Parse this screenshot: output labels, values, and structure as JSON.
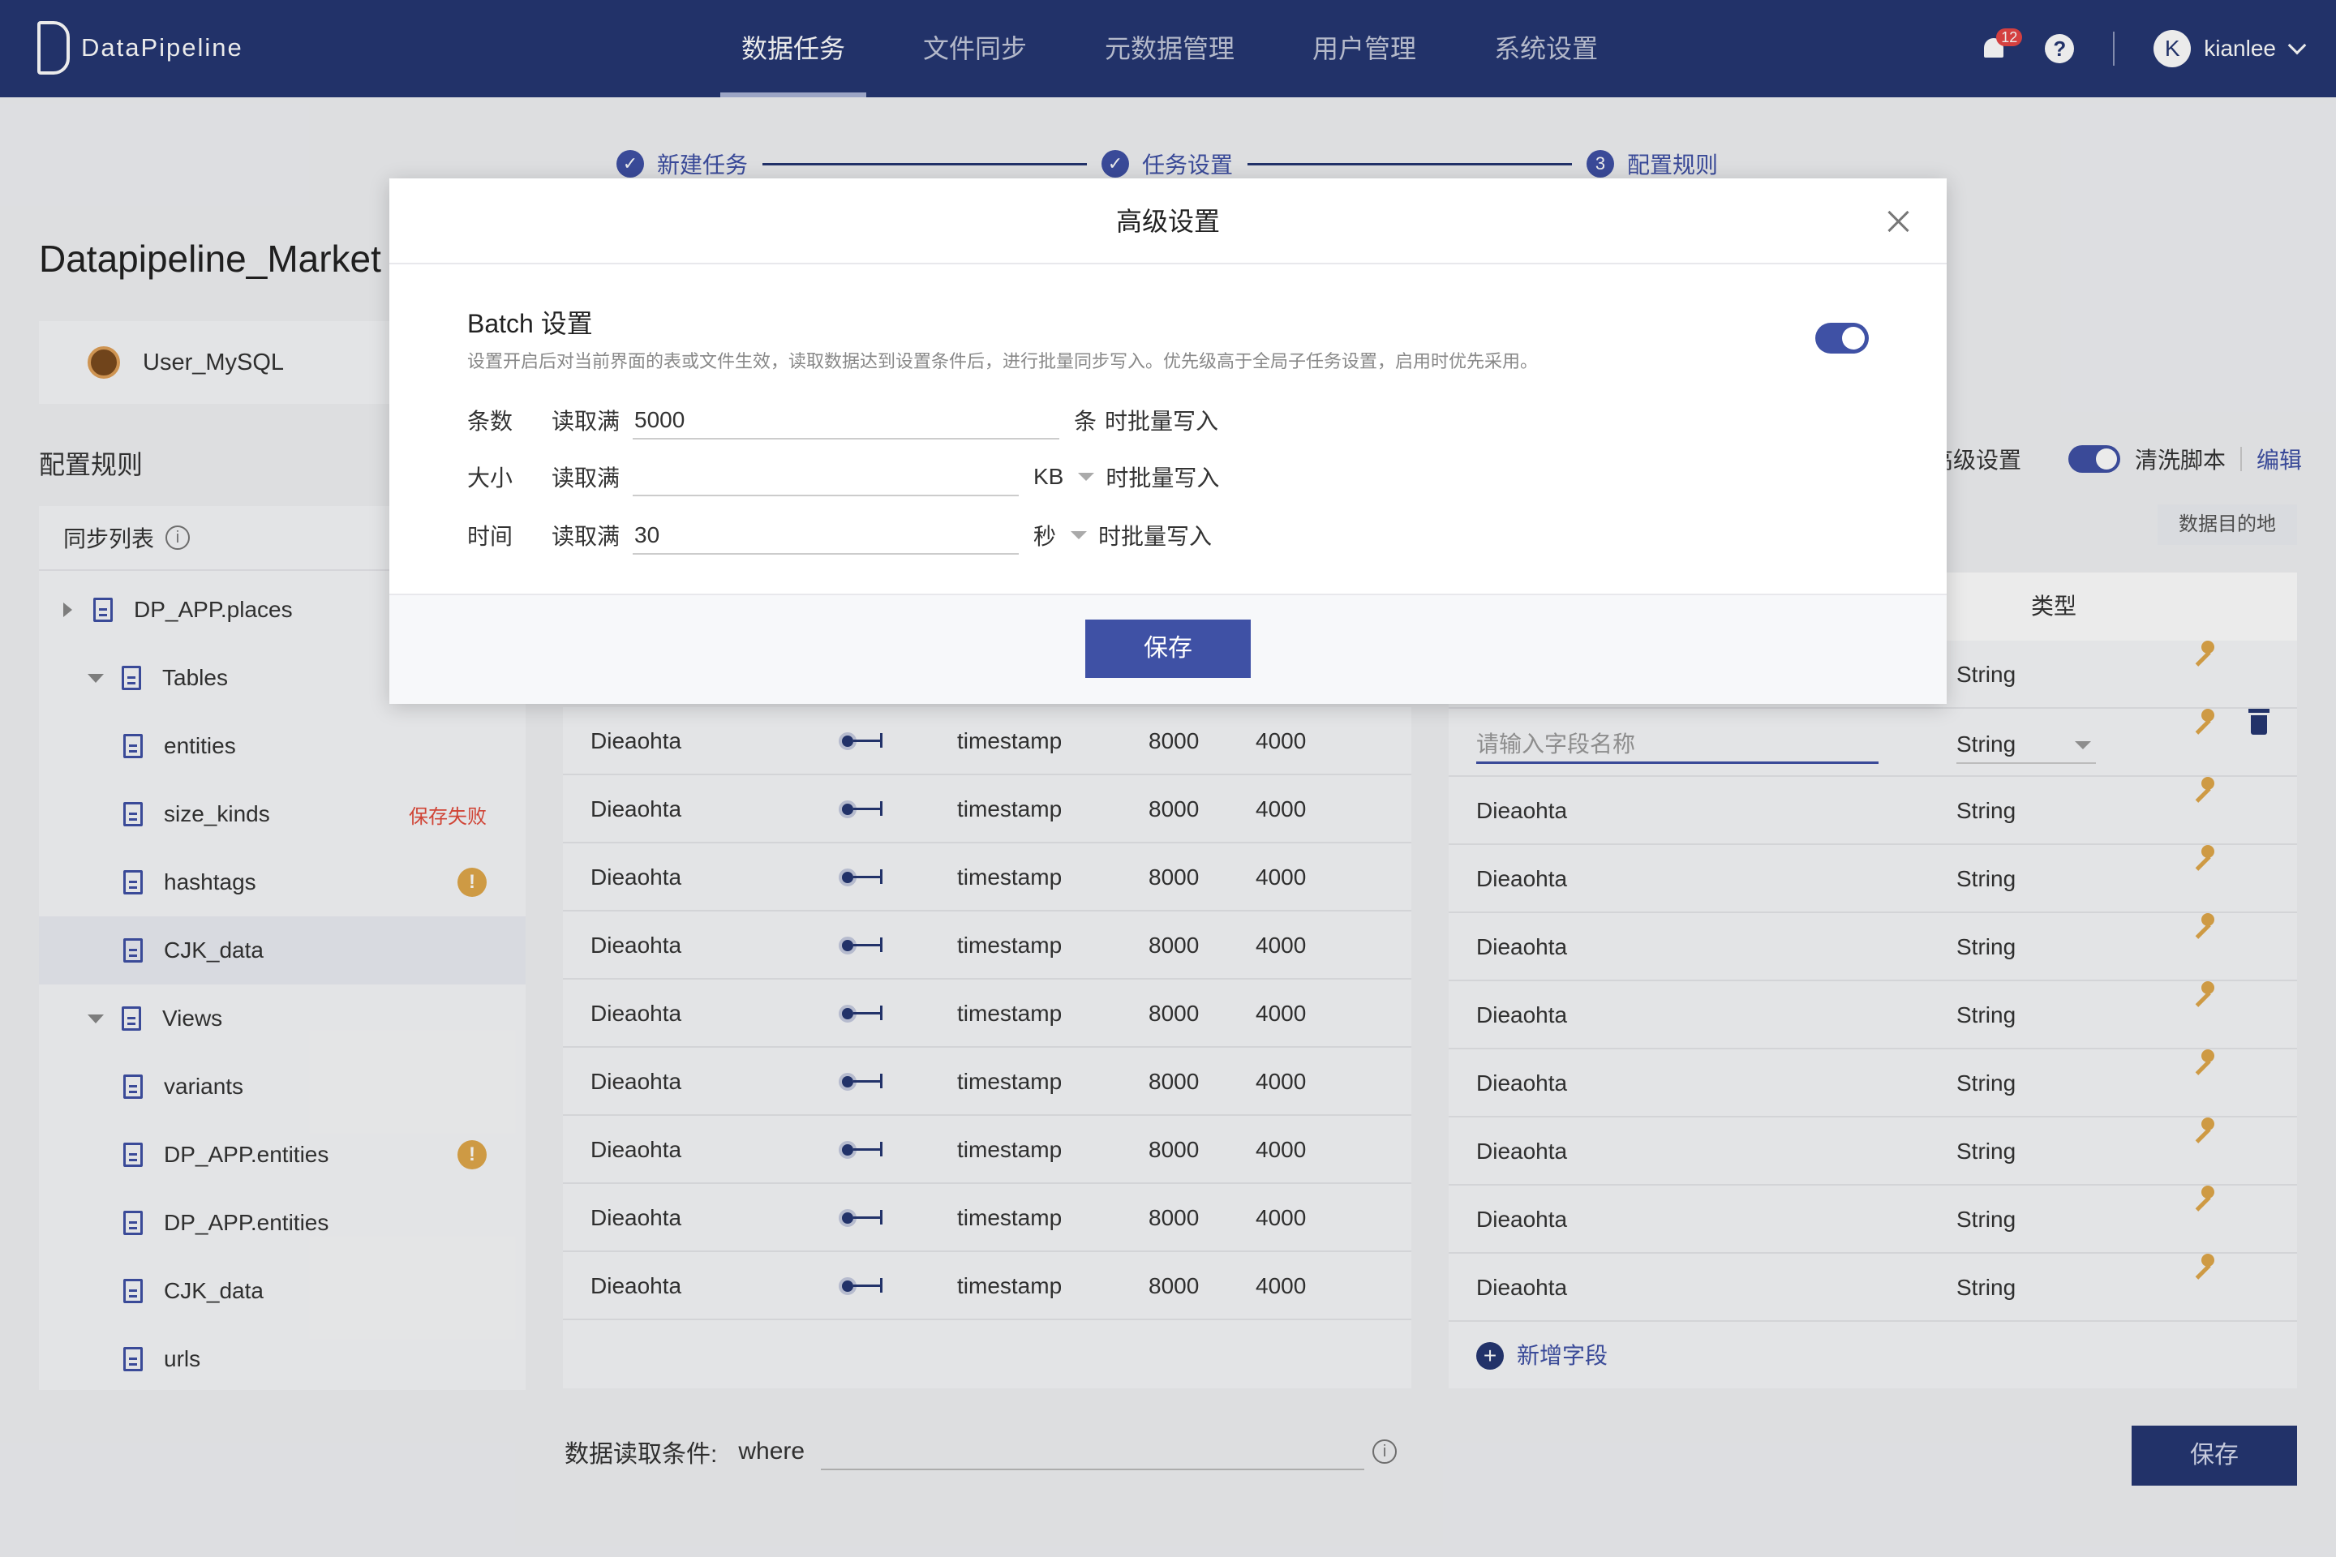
{
  "app": {
    "brand": "DataPipeline"
  },
  "nav": {
    "items": [
      "数据任务",
      "文件同步",
      "元数据管理",
      "用户管理",
      "系统设置"
    ],
    "active": "数据任务"
  },
  "user": {
    "notifications": "12",
    "help": "?",
    "avatar_letter": "K",
    "name": "kianlee"
  },
  "steps": [
    {
      "label": "新建任务",
      "marker": "✓"
    },
    {
      "label": "任务设置",
      "marker": "✓"
    },
    {
      "label": "配置规则",
      "marker": "3"
    }
  ],
  "page": {
    "title": "Datapipeline_Market",
    "source": "User_MySQL",
    "section_title": "配置规则"
  },
  "tree": {
    "header": "同步列表",
    "info": "i",
    "items": [
      {
        "label": "DP_APP.places",
        "status": ""
      },
      {
        "label": "Tables",
        "status": ""
      },
      {
        "label": "entities",
        "status": ""
      },
      {
        "label": "size_kinds",
        "status": "保存失败"
      },
      {
        "label": "hashtags",
        "status": "!"
      },
      {
        "label": "CJK_data",
        "status": ""
      },
      {
        "label": "Views",
        "status": ""
      },
      {
        "label": "variants",
        "status": ""
      },
      {
        "label": "DP_APP.entities",
        "status": "!"
      },
      {
        "label": "DP_APP.entities",
        "status": ""
      },
      {
        "label": "CJK_data",
        "status": ""
      },
      {
        "label": "urls",
        "status": ""
      }
    ]
  },
  "source_rows": [
    {
      "name": "Dieaohta",
      "type": "timestamp",
      "len": "8000",
      "size": "4000"
    },
    {
      "name": "Dieaohta",
      "type": "timestamp",
      "len": "8000",
      "size": "4000"
    },
    {
      "name": "Dieaohta",
      "type": "timestamp",
      "len": "8000",
      "size": "4000"
    },
    {
      "name": "Dieaohta",
      "type": "timestamp",
      "len": "8000",
      "size": "4000"
    },
    {
      "name": "Dieaohta",
      "type": "timestamp",
      "len": "8000",
      "size": "4000"
    },
    {
      "name": "Dieaohta",
      "type": "timestamp",
      "len": "8000",
      "size": "4000"
    },
    {
      "name": "Dieaohta",
      "type": "timestamp",
      "len": "8000",
      "size": "4000"
    },
    {
      "name": "Dieaohta",
      "type": "timestamp",
      "len": "8000",
      "size": "4000"
    },
    {
      "name": "Dieaohta",
      "type": "timestamp",
      "len": "8000",
      "size": "4000"
    }
  ],
  "right": {
    "advanced_label": "高级设置",
    "clean_script_label": "清洗脚本",
    "edit_label": "编辑",
    "dest_tag": "数据目的地",
    "type_header": "类型",
    "field_placeholder": "请输入字段名称",
    "rows": [
      {
        "name": "",
        "type": "String"
      },
      {
        "name": "",
        "type": "String",
        "editing": true
      },
      {
        "name": "Dieaohta",
        "type": "String"
      },
      {
        "name": "Dieaohta",
        "type": "String"
      },
      {
        "name": "Dieaohta",
        "type": "String"
      },
      {
        "name": "Dieaohta",
        "type": "String"
      },
      {
        "name": "Dieaohta",
        "type": "String"
      },
      {
        "name": "Dieaohta",
        "type": "String"
      },
      {
        "name": "Dieaohta",
        "type": "String"
      },
      {
        "name": "Dieaohta",
        "type": "String"
      }
    ],
    "add_field": "新增字段"
  },
  "where": {
    "label": "数据读取条件:",
    "keyword": "where",
    "value": ""
  },
  "save_label": "保存",
  "modal": {
    "title": "高级设置",
    "batch_title": "Batch 设置",
    "batch_desc": "设置开启后对当前界面的表或文件生效，读取数据达到设置条件后，进行批量同步写入。优先级高于全局子任务设置，启用时优先采用。",
    "toggle_on": true,
    "rows": [
      {
        "label": "条数",
        "prefix": "读取满",
        "value": "5000",
        "unit": "条",
        "suffix": "时批量写入"
      },
      {
        "label": "大小",
        "prefix": "读取满",
        "value": "",
        "unit": "KB",
        "suffix": "时批量写入"
      },
      {
        "label": "时间",
        "prefix": "读取满",
        "value": "30",
        "unit": "秒",
        "suffix": "时批量写入"
      }
    ],
    "save_label": "保存"
  },
  "colors": {
    "nav_bg": "#253772",
    "accent": "#3f51a5",
    "warning": "#e0a84a",
    "error": "#e24a3b"
  }
}
